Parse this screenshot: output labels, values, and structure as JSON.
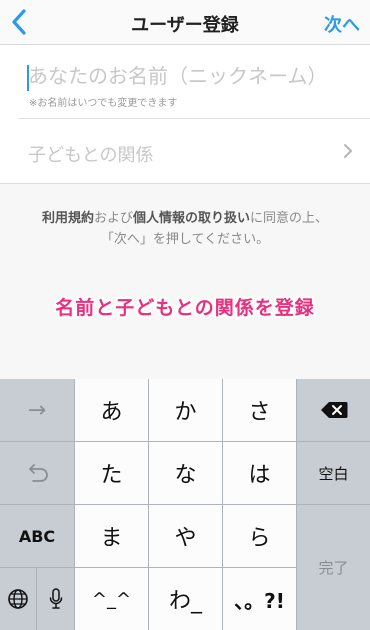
{
  "nav": {
    "title": "ユーザー登録",
    "next_label": "次へ"
  },
  "form": {
    "name_placeholder": "あなたのお名前（ニックネーム）",
    "name_value": "",
    "name_note": "※お名前はいつでも変更できます",
    "relation_label": "子どもとの関係"
  },
  "terms": {
    "line1_part1": "利用規約",
    "line1_part2": "および",
    "line1_part3": "個人情報の取り扱い",
    "line1_part4": "に同意の上、",
    "line2": "「次へ」を押してください。"
  },
  "annotation": "名前と子どもとの関係を登録",
  "keyboard": {
    "row1": [
      "→",
      "あ",
      "か",
      "さ",
      "delete"
    ],
    "row2": [
      "undo",
      "た",
      "な",
      "は",
      "空白"
    ],
    "row3": [
      "ABC",
      "ま",
      "や",
      "ら",
      "完了"
    ],
    "row4": [
      "globe",
      "mic",
      "^_^",
      "わ_",
      "、。?!"
    ],
    "accent_color": "#2b9be8",
    "annotation_color": "#ec2f7d"
  }
}
